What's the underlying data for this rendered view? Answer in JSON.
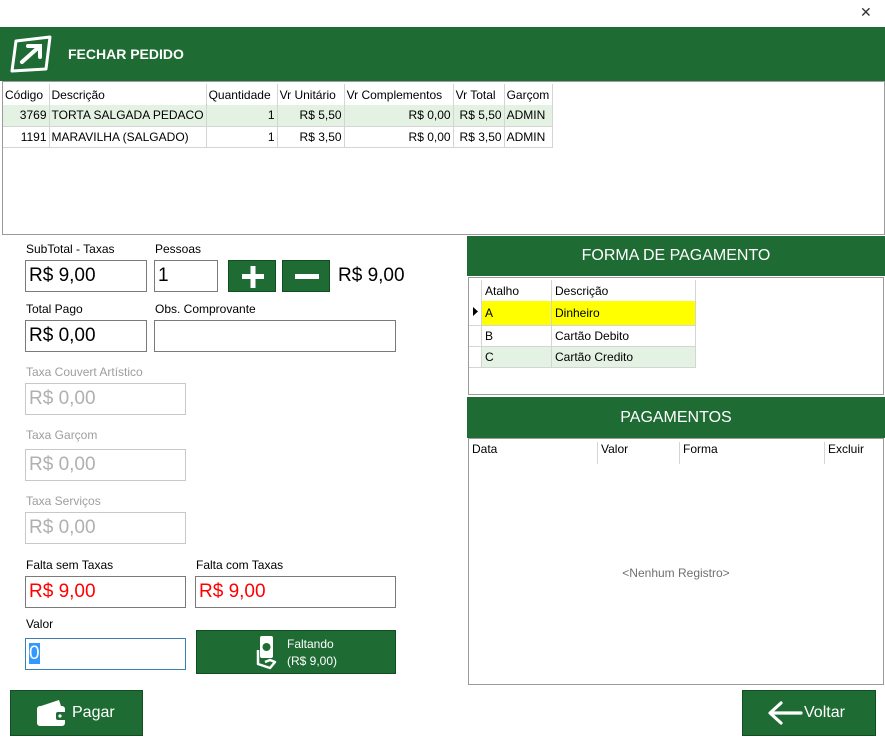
{
  "window": {
    "close_label": "✕"
  },
  "header": {
    "title": "FECHAR PEDIDO"
  },
  "items_table": {
    "columns": [
      "Código",
      "Descrição",
      "Quantidade",
      "Vr Unitário",
      "Vr Complementos",
      "Vr Total",
      "Garçom"
    ],
    "rows": [
      [
        "3769",
        "TORTA SALGADA PEDACO",
        "1",
        "R$ 5,50",
        "R$ 0,00",
        "R$ 5,50",
        "ADMIN"
      ],
      [
        "1191",
        "MARAVILHA (SALGADO)",
        "1",
        "R$ 3,50",
        "R$ 0,00",
        "R$ 3,50",
        "ADMIN"
      ]
    ]
  },
  "form": {
    "subtotal_label": "SubTotal - Taxas",
    "subtotal_value": "R$ 9,00",
    "pessoas_label": "Pessoas",
    "pessoas_value": "1",
    "per_person_value": "R$ 9,00",
    "total_pago_label": "Total Pago",
    "total_pago_value": "R$ 0,00",
    "obs_label": "Obs. Comprovante",
    "obs_value": "",
    "couvert_label": "Taxa Couvert Artístico",
    "couvert_value": "R$ 0,00",
    "garcom_label": "Taxa Garçom",
    "garcom_value": "R$ 0,00",
    "servicos_label": "Taxa Serviços",
    "servicos_value": "R$ 0,00",
    "falta_sem_label": "Falta sem Taxas",
    "falta_sem_value": "R$ 9,00",
    "falta_com_label": "Falta com Taxas",
    "falta_com_value": "R$ 9,00",
    "valor_label": "Valor",
    "valor_value": "0",
    "faltando_line1": "Faltando",
    "faltando_line2": "(R$ 9,00)"
  },
  "forma_pagamento": {
    "title": "FORMA DE PAGAMENTO",
    "columns": [
      "Atalho",
      "Descrição"
    ],
    "rows": [
      [
        "A",
        "Dinheiro"
      ],
      [
        "B",
        "Cartão Debito"
      ],
      [
        "C",
        "Cartão Credito"
      ]
    ]
  },
  "pagamentos": {
    "title": "PAGAMENTOS",
    "columns": [
      "Data",
      "Valor",
      "Forma",
      "Excluir"
    ],
    "empty_text": "<Nenhum Registro>"
  },
  "buttons": {
    "pagar": "Pagar",
    "voltar": "Voltar"
  },
  "colors": {
    "brand_green": "#1e6b33",
    "row_alt": "#e4f2e4",
    "selected_row": "#ffff00",
    "alert_red": "#ff0000"
  },
  "icons": [
    "logo-icon",
    "plus-icon",
    "minus-icon",
    "money-hand-icon",
    "wallet-icon",
    "arrow-left-icon",
    "row-pointer-icon"
  ]
}
